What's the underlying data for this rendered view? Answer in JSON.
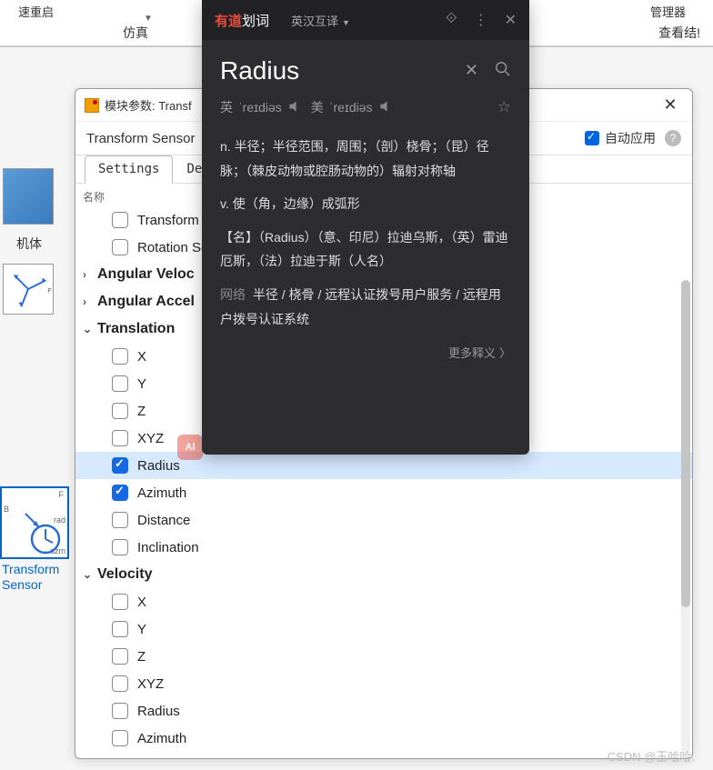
{
  "top": {
    "left_label": "速重启",
    "left_sub": "仿真",
    "right_label1": "管理器",
    "right_label2": "查看结!"
  },
  "sidebar": {
    "label1": "机体",
    "label3": "Transform\nSensor",
    "port_labels": {
      "f": "F",
      "b": "B",
      "rad": "rad",
      "azm": "azm"
    }
  },
  "dialog": {
    "title": "模块参数: Transf",
    "subtitle": "Transform Sensor",
    "auto_apply": "自动应用",
    "tabs": [
      "Settings",
      "Descr"
    ],
    "tree_header": "名称",
    "tree": [
      {
        "type": "check",
        "label": "Transform",
        "checked": false,
        "indent": 1
      },
      {
        "type": "check",
        "label": "Rotation Se",
        "checked": false,
        "indent": 1
      },
      {
        "type": "group",
        "label": "Angular Veloc",
        "open": false
      },
      {
        "type": "group",
        "label": "Angular Accel",
        "open": false
      },
      {
        "type": "group",
        "label": "Translation",
        "open": true
      },
      {
        "type": "check",
        "label": "X",
        "checked": false,
        "indent": 1
      },
      {
        "type": "check",
        "label": "Y",
        "checked": false,
        "indent": 1
      },
      {
        "type": "check",
        "label": "Z",
        "checked": false,
        "indent": 1
      },
      {
        "type": "check",
        "label": "XYZ",
        "checked": false,
        "indent": 1
      },
      {
        "type": "check",
        "label": "Radius",
        "checked": true,
        "indent": 1,
        "highlight": true
      },
      {
        "type": "check",
        "label": "Azimuth",
        "checked": true,
        "indent": 1
      },
      {
        "type": "check",
        "label": "Distance",
        "checked": false,
        "indent": 1
      },
      {
        "type": "check",
        "label": "Inclination",
        "checked": false,
        "indent": 1
      },
      {
        "type": "group",
        "label": "Velocity",
        "open": true
      },
      {
        "type": "check",
        "label": "X",
        "checked": false,
        "indent": 1
      },
      {
        "type": "check",
        "label": "Y",
        "checked": false,
        "indent": 1
      },
      {
        "type": "check",
        "label": "Z",
        "checked": false,
        "indent": 1
      },
      {
        "type": "check",
        "label": "XYZ",
        "checked": false,
        "indent": 1
      },
      {
        "type": "check",
        "label": "Radius",
        "checked": false,
        "indent": 1
      },
      {
        "type": "check",
        "label": "Azimuth",
        "checked": false,
        "indent": 1
      }
    ]
  },
  "dict": {
    "logo_red": "有道",
    "logo_rest": "划词",
    "mode": "英汉互译",
    "word": "Radius",
    "pron_uk_label": "英",
    "pron_uk": "ˈreɪdiəs",
    "pron_us_label": "美",
    "pron_us": "ˈreɪdiəs",
    "def_n": "n. 半径；半径范围，周围；（剖）桡骨；（昆）径脉；（棘皮动物或腔肠动物的）辐射对称轴",
    "def_v": "v. 使（角，边缘）成弧形",
    "def_name": "【名】（Radius）（意、印尼）拉迪乌斯，（英）雷迪厄斯，（法）拉迪于斯（人名）",
    "net_label": "网络",
    "def_net": "半径 / 桡骨 / 远程认证拨号用户服务 / 远程用户拨号认证系统",
    "more": "更多释义"
  },
  "ai_badge": "AI",
  "watermark": "CSDN @王哈哈."
}
